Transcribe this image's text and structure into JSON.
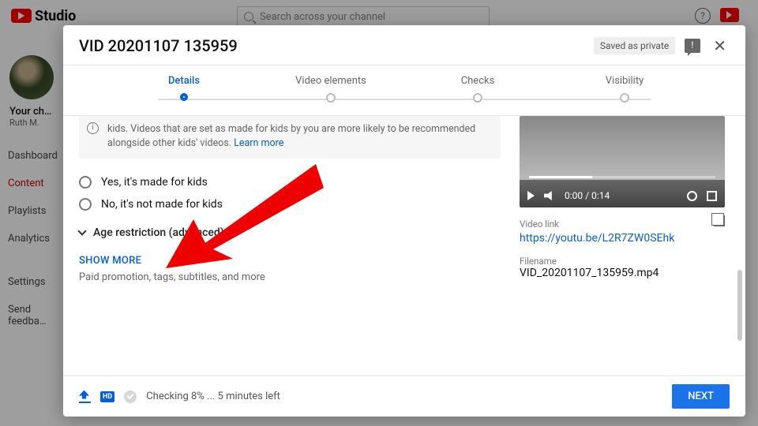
{
  "app": {
    "brand": "Studio",
    "search_placeholder": "Search across your channel",
    "channel_label": "Your ch…",
    "channel_sub": "Ruth M.",
    "nav": {
      "dashboard": "Dashboard",
      "content": "Content",
      "playlists": "Playlists",
      "analytics": "Analytics",
      "settings": "Settings",
      "feedback": "Send feedba…"
    }
  },
  "modal": {
    "title": "VID 20201107 135959",
    "saved_chip": "Saved as private",
    "steps": {
      "details": "Details",
      "elements": "Video elements",
      "checks": "Checks",
      "visibility": "Visibility"
    },
    "info_text": "kids. Videos that are set as made for kids by you are more likely to be recommended alongside other kids' videos. ",
    "info_link": "Learn more",
    "radio_yes": "Yes, it's made for kids",
    "radio_no": "No, it's not made for kids",
    "age_restriction": "Age restriction (advanced)",
    "show_more": "SHOW MORE",
    "show_more_sub": "Paid promotion, tags, subtitles, and more",
    "preview_time": "0:00 / 0:14",
    "link_label": "Video link",
    "link_value": "https://youtu.be/L2R7ZW0SEhk",
    "filename_label": "Filename",
    "filename_value": "VID_20201107_135959.mp4",
    "status": "Checking 8% ... 5 minutes left",
    "hd": "HD",
    "next": "NEXT"
  }
}
